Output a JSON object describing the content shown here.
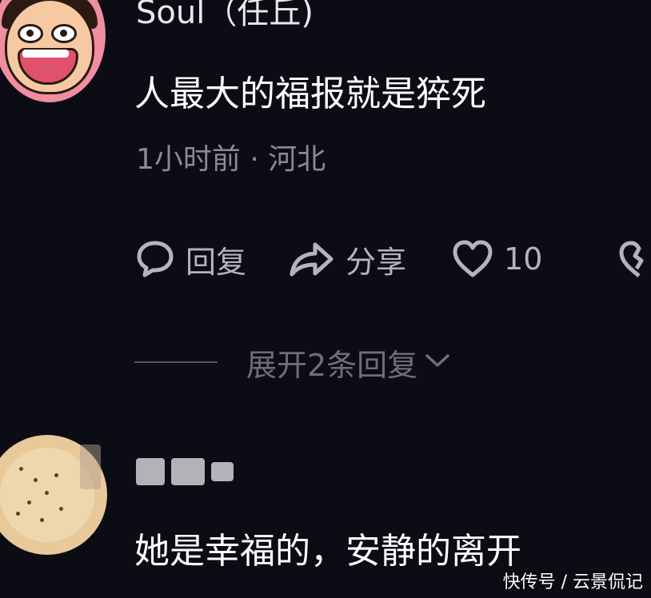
{
  "comment1": {
    "username": "Soul（任丘)",
    "text": "人最大的福报就是猝死",
    "meta": "1小时前 · 河北",
    "actions": {
      "reply_label": "回复",
      "share_label": "分享",
      "like_count": "10"
    },
    "expand_label": "展开2条回复"
  },
  "comment2": {
    "text": "她是幸福的，安静的离开"
  },
  "watermark": "快传号 / 云景侃记",
  "colors": {
    "background": "#0c0c14",
    "primary_text": "#ffffff",
    "secondary_text": "#8a8a96",
    "action_text": "#b4b4be",
    "expand_text": "#6e6e78",
    "avatar1_bg": "#f08da0"
  },
  "icons": {
    "reply": "speech-bubble-icon",
    "share": "share-arrow-icon",
    "like": "heart-icon",
    "dislike": "broken-heart-icon",
    "expand": "chevron-down-icon"
  }
}
